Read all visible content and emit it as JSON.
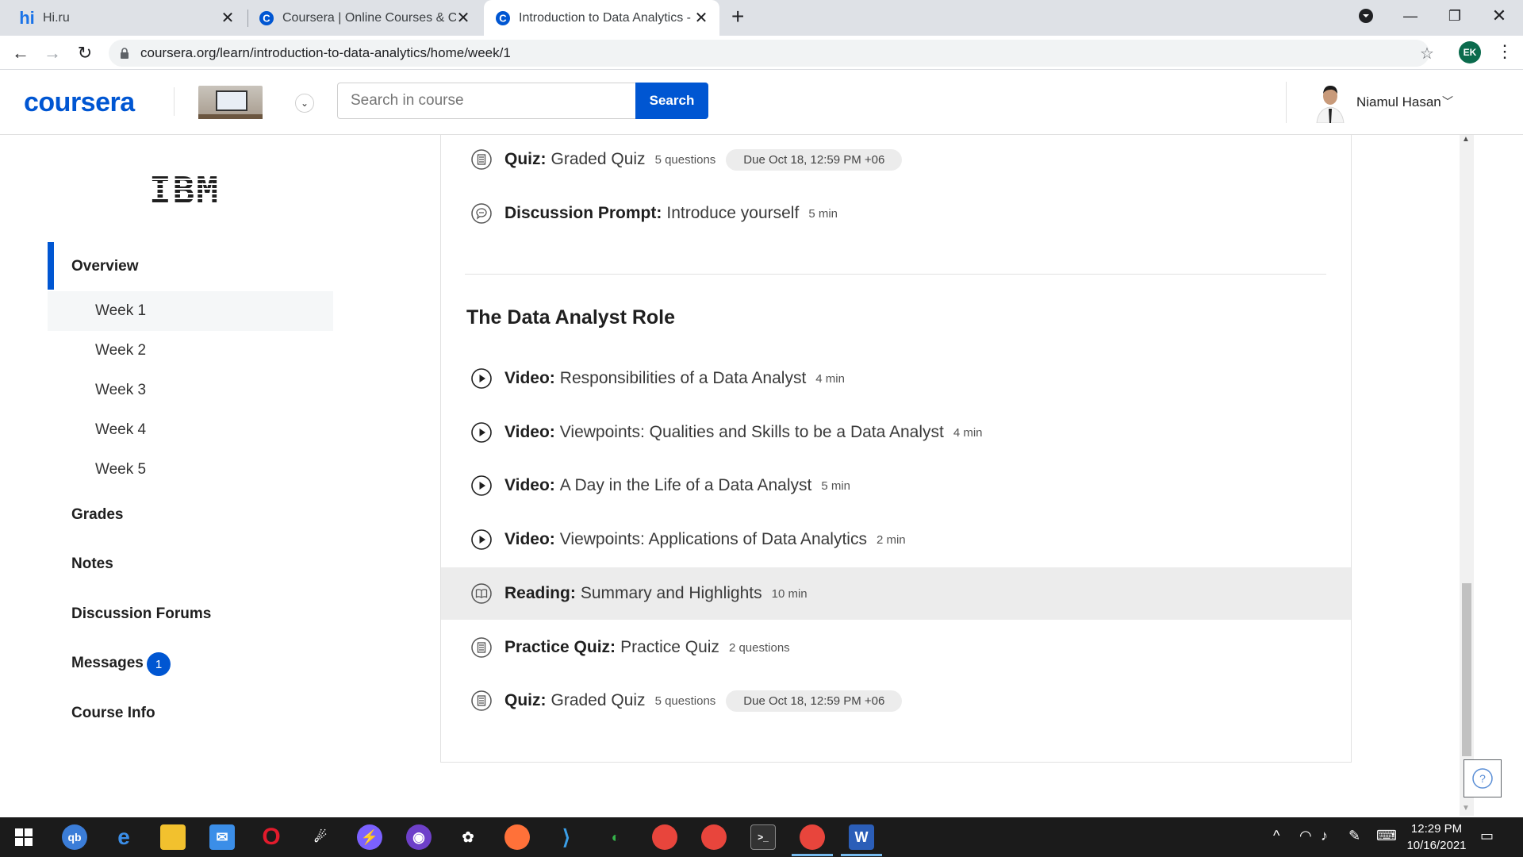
{
  "browser": {
    "tabs": [
      {
        "title": "Hi.ru",
        "favicon": "hi-icon"
      },
      {
        "title": "Coursera | Online Courses & Crec",
        "favicon": "coursera-icon"
      },
      {
        "title": "Introduction to Data Analytics - V",
        "favicon": "coursera-icon",
        "active": true
      }
    ],
    "url": "coursera.org/learn/introduction-to-data-analytics/home/week/1",
    "profile_initials": "EK"
  },
  "header": {
    "logo": "coursera",
    "search_placeholder": "Search in course",
    "search_button": "Search",
    "user_name": "Niamul Hasan"
  },
  "sidebar": {
    "partner_logo": "IBM",
    "overview": "Overview",
    "weeks": [
      "Week 1",
      "Week 2",
      "Week 3",
      "Week 4",
      "Week 5"
    ],
    "grades": "Grades",
    "notes": "Notes",
    "forums": "Discussion Forums",
    "messages": "Messages",
    "messages_count": "1",
    "course_info": "Course Info"
  },
  "main": {
    "top_items": [
      {
        "kind": "Quiz:",
        "name": "Graded Quiz",
        "meta": "5 questions",
        "due": "Due Oct 18, 12:59 PM +06",
        "icon": "quiz-icon"
      },
      {
        "kind": "Discussion Prompt:",
        "name": "Introduce yourself",
        "meta": "5 min",
        "icon": "discussion-icon"
      }
    ],
    "section_title": "The Data Analyst Role",
    "items": [
      {
        "kind": "Video:",
        "name": "Responsibilities of a Data Analyst",
        "meta": "4 min",
        "icon": "play-icon"
      },
      {
        "kind": "Video:",
        "name": "Viewpoints: Qualities and Skills to be a Data Analyst",
        "meta": "4 min",
        "icon": "play-icon"
      },
      {
        "kind": "Video:",
        "name": "A Day in the Life of a Data Analyst",
        "meta": "5 min",
        "icon": "play-icon"
      },
      {
        "kind": "Video:",
        "name": "Viewpoints: Applications of Data Analytics",
        "meta": "2 min",
        "icon": "play-icon"
      },
      {
        "kind": "Reading:",
        "name": "Summary and Highlights",
        "meta": "10 min",
        "icon": "reading-icon"
      },
      {
        "kind": "Practice Quiz:",
        "name": "Practice Quiz",
        "meta": "2 questions",
        "icon": "quiz-icon"
      },
      {
        "kind": "Quiz:",
        "name": "Graded Quiz",
        "meta": "5 questions",
        "due": "Due Oct 18, 12:59 PM +06",
        "icon": "quiz-icon"
      }
    ]
  },
  "taskbar": {
    "time": "12:29 PM",
    "date": "10/16/2021"
  },
  "colors": {
    "accent": "#0056d2",
    "highlight_row": "#ececec"
  }
}
